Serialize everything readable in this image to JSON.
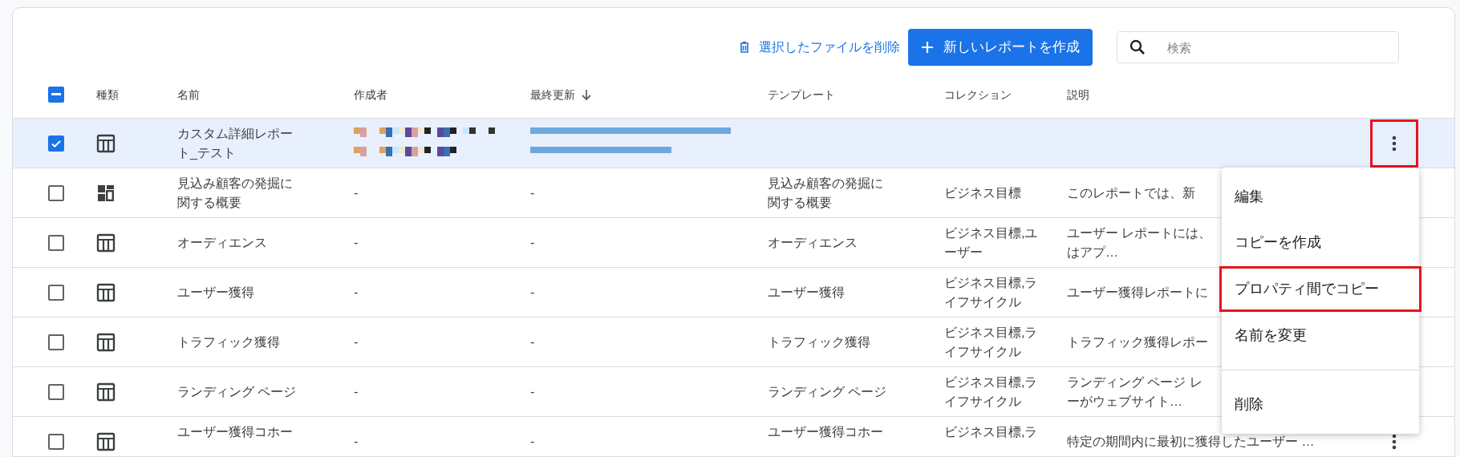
{
  "toolbar": {
    "delete_label": "選択したファイルを削除",
    "create_label": "新しいレポートを作成",
    "search": {
      "placeholder": "検索"
    }
  },
  "table": {
    "select_all": {
      "indeterminate": true
    },
    "columns": [
      {
        "label": "種類",
        "sorted": false
      },
      {
        "label": "名前",
        "sorted": false
      },
      {
        "label": "作成者",
        "sorted": false
      },
      {
        "label": "最終更新",
        "sorted": true
      },
      {
        "label": "テンプレート",
        "sorted": false
      },
      {
        "label": "コレクション",
        "sorted": false
      },
      {
        "label": "説明",
        "sorted": false
      }
    ],
    "rows": [
      {
        "checked": true,
        "kind": "table",
        "name": "カスタム詳細レポート_テスト",
        "creator_redacted": true,
        "updated_redacted": true,
        "menu_highlighted": true,
        "cut_off": false
      },
      {
        "checked": false,
        "kind": "dashboard",
        "name": "見込み顧客の発掘に関する概要",
        "creator": "-",
        "updated": "-",
        "template": "見込み顧客の発掘に関する概要",
        "collection": "ビジネス目標",
        "description_lines": [
          "このレポートでは、新"
        ],
        "cut_off": false
      },
      {
        "checked": false,
        "kind": "table",
        "name": "オーディエンス",
        "creator": "-",
        "updated": "-",
        "template": "オーディエンス",
        "collection": "ビジネス目標,ユーザー",
        "description_lines": [
          "ユーザー レポートには、",
          "はアプ…"
        ],
        "cut_off": false
      },
      {
        "checked": false,
        "kind": "table",
        "name": "ユーザー獲得",
        "creator": "-",
        "updated": "-",
        "template": "ユーザー獲得",
        "collection": "ビジネス目標,ライフサイクル",
        "description_lines": [
          "ユーザー獲得レポートに"
        ],
        "cut_off": false
      },
      {
        "checked": false,
        "kind": "table",
        "name": "トラフィック獲得",
        "creator": "-",
        "updated": "-",
        "template": "トラフィック獲得",
        "collection": "ビジネス目標,ライフサイクル",
        "description_lines": [
          "トラフィック獲得レポー"
        ],
        "cut_off": false
      },
      {
        "checked": false,
        "kind": "table",
        "name": "ランディング ページ",
        "creator": "-",
        "updated": "-",
        "template": "ランディング ページ",
        "collection": "ビジネス目標,ライフサイクル",
        "description_lines": [
          "ランディング ページ レ",
          "ーがウェブサイト…"
        ],
        "cut_off": false
      },
      {
        "checked": false,
        "kind": "table",
        "name": "ユーザー獲得コホー",
        "creator": "-",
        "updated": "-",
        "template": "ユーザー獲得コホー",
        "collection": "ビジネス目標,ラ",
        "description_lines": [
          "特定の期間内に最初に獲得したユーザー …"
        ],
        "menu_highlighted": false,
        "cut_off": true
      }
    ]
  },
  "context_menu": {
    "items": [
      {
        "label": "編集",
        "highlighted": false,
        "divider_before": false
      },
      {
        "label": "コピーを作成",
        "highlighted": false,
        "divider_before": false
      },
      {
        "label": "プロパティ間でコピー",
        "highlighted": true,
        "divider_before": false
      },
      {
        "label": "名前を変更",
        "highlighted": false,
        "divider_before": false
      },
      {
        "label": "削除",
        "highlighted": false,
        "divider_before": true
      }
    ]
  }
}
